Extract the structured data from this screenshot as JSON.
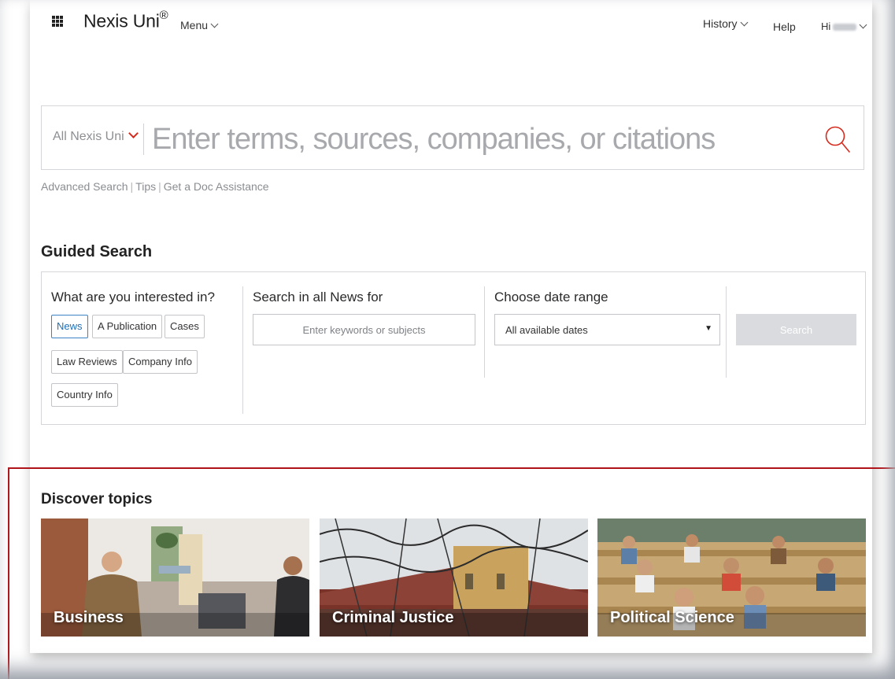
{
  "header": {
    "brand": "Nexis Uni",
    "brand_mark": "®",
    "menu_label": "Menu",
    "history_label": "History",
    "help_label": "Help",
    "greeting": "Hi"
  },
  "search": {
    "scope_label": "All Nexis Uni",
    "placeholder": "Enter terms, sources, companies, or citations",
    "links": [
      "Advanced Search",
      "Tips",
      "Get a Doc Assistance"
    ]
  },
  "guided": {
    "title": "Guided Search",
    "interest_title": "What are you interested in?",
    "chips": [
      "News",
      "A Publication",
      "Cases",
      "Law Reviews",
      "Company Info",
      "Country Info"
    ],
    "active_chip": "News",
    "search_in_title": "Search in all News for",
    "keyword_placeholder": "Enter keywords or subjects",
    "date_title": "Choose date range",
    "date_value": "All available dates",
    "search_button": "Search"
  },
  "discover": {
    "title": "Discover topics",
    "topics": [
      "Business",
      "Criminal Justice",
      "Political Science"
    ]
  },
  "colors": {
    "accent_red": "#d52b1e",
    "active_chip_blue": "#1f6fb6",
    "highlight_outline": "#b0141a",
    "disabled_button": "#d9dbde"
  }
}
